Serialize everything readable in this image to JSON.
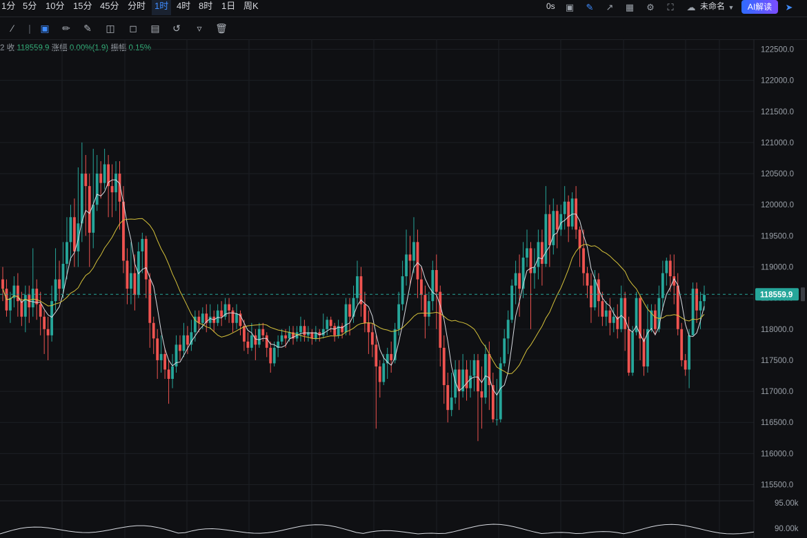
{
  "topbar": {
    "intervals": [
      "1分",
      "5分",
      "10分",
      "15分",
      "45分",
      "分时",
      "1时",
      "4时",
      "8时",
      "1日",
      "周K"
    ],
    "active_interval": "1时",
    "countdown": "0s",
    "layout_name": "未命名",
    "ai_button": "AI解读"
  },
  "toolbar": {
    "tools": [
      "line-tool-icon",
      "select-icon",
      "ruler-icon",
      "brush-icon",
      "candle-style-icon",
      "square-tool-icon",
      "note-icon",
      "magnet-icon",
      "filter-icon",
      "trash-icon"
    ]
  },
  "info": {
    "prefix": "2",
    "close_label": "收",
    "close_value": "118559.9",
    "change_label": "涨幅",
    "change_value": "0.00%(1.9)",
    "amp_label": "振幅",
    "amp_value": "0.15%"
  },
  "colors": {
    "up": "#26a69a",
    "down": "#ef5350",
    "ma_fast": "#d9dce2",
    "ma_slow": "#d6c23a",
    "price_tag": "#26a69a"
  },
  "chart_data": {
    "type": "candlestick",
    "y_ticks": [
      "122500.0",
      "122000.0",
      "121500.0",
      "121000.0",
      "120500.0",
      "120000.0",
      "119500.0",
      "119000.0",
      "118500.0",
      "118000.0",
      "117500.0",
      "117000.0",
      "116500.0",
      "116000.0",
      "115500.0"
    ],
    "ylim": [
      115500,
      122500
    ],
    "last_price": "118559.9",
    "last_price_value": 118559.9,
    "volume_ticks": [
      "95.00k",
      "90.00k"
    ],
    "candles": [
      [
        118800,
        118650,
        118450,
        119000
      ],
      [
        118650,
        118300,
        118200,
        118800
      ],
      [
        118300,
        118500,
        118100,
        118600
      ],
      [
        118500,
        118700,
        118350,
        118850
      ],
      [
        118700,
        118450,
        118200,
        118900
      ],
      [
        118450,
        118200,
        118050,
        118600
      ],
      [
        118200,
        118550,
        117950,
        118700
      ],
      [
        118550,
        118350,
        118100,
        118700
      ],
      [
        118350,
        118650,
        118200,
        119300
      ],
      [
        118650,
        118400,
        118150,
        118800
      ],
      [
        118400,
        118200,
        117900,
        118600
      ],
      [
        118200,
        118000,
        117600,
        118300
      ],
      [
        118000,
        117900,
        117500,
        118200
      ],
      [
        117900,
        118450,
        117800,
        118700
      ],
      [
        118450,
        118800,
        118300,
        119300
      ],
      [
        118800,
        118650,
        118450,
        119100
      ],
      [
        118650,
        119050,
        118500,
        119400
      ],
      [
        119050,
        119400,
        118800,
        119800
      ],
      [
        119400,
        119800,
        119100,
        120000
      ],
      [
        119800,
        119250,
        119000,
        120100
      ],
      [
        119250,
        119700,
        119000,
        120600
      ],
      [
        119700,
        120500,
        119400,
        121000
      ],
      [
        120500,
        120300,
        119500,
        120800
      ],
      [
        120300,
        119550,
        119000,
        120500
      ],
      [
        119550,
        120000,
        119300,
        120900
      ],
      [
        120000,
        120500,
        119900,
        120800
      ],
      [
        120500,
        120350,
        120100,
        120700
      ],
      [
        120350,
        120650,
        120250,
        120900
      ],
      [
        120650,
        120300,
        119800,
        120800
      ],
      [
        120300,
        120200,
        119800,
        120650
      ],
      [
        120200,
        120500,
        119900,
        120700
      ],
      [
        120500,
        120050,
        119600,
        120700
      ],
      [
        120050,
        119100,
        118900,
        120300
      ],
      [
        119100,
        118650,
        118400,
        119300
      ],
      [
        118650,
        118900,
        118400,
        119400
      ],
      [
        118900,
        118550,
        118300,
        119200
      ],
      [
        118550,
        119250,
        118500,
        119400
      ],
      [
        119250,
        119450,
        118900,
        119550
      ],
      [
        119450,
        118800,
        118500,
        119500
      ],
      [
        118800,
        118100,
        117700,
        118900
      ],
      [
        118100,
        117850,
        117600,
        118200
      ],
      [
        117850,
        117500,
        117200,
        118000
      ],
      [
        117500,
        117600,
        117300,
        117900
      ],
      [
        117600,
        117350,
        117200,
        117700
      ],
      [
        117350,
        117200,
        116800,
        117500
      ],
      [
        117200,
        117400,
        117050,
        117600
      ],
      [
        117400,
        117750,
        117300,
        117900
      ],
      [
        117750,
        117650,
        117500,
        117900
      ],
      [
        117650,
        117900,
        117550,
        118100
      ],
      [
        117900,
        117750,
        117600,
        118050
      ],
      [
        117750,
        117950,
        117650,
        118150
      ],
      [
        117950,
        118200,
        117800,
        118300
      ],
      [
        118200,
        118100,
        117950,
        118300
      ],
      [
        118100,
        118250,
        118000,
        118350
      ],
      [
        118250,
        118100,
        117950,
        118400
      ],
      [
        118100,
        118200,
        118000,
        118400
      ],
      [
        118200,
        118100,
        117950,
        118300
      ],
      [
        118100,
        118300,
        118050,
        118400
      ],
      [
        118300,
        118200,
        118050,
        118450
      ],
      [
        118200,
        118400,
        118150,
        118500
      ],
      [
        118400,
        118300,
        118100,
        118500
      ],
      [
        118300,
        118100,
        117950,
        118350
      ],
      [
        118100,
        118250,
        118000,
        118400
      ],
      [
        118250,
        118050,
        117900,
        118300
      ],
      [
        118050,
        117800,
        117650,
        118150
      ],
      [
        117800,
        117700,
        117600,
        117950
      ],
      [
        117700,
        117900,
        117650,
        118100
      ],
      [
        117900,
        117750,
        117500,
        118000
      ],
      [
        117750,
        118000,
        117700,
        118100
      ],
      [
        118000,
        117900,
        117800,
        118100
      ],
      [
        117900,
        117700,
        117550,
        117950
      ],
      [
        117700,
        117450,
        117300,
        117800
      ],
      [
        117450,
        117700,
        117400,
        117800
      ],
      [
        117700,
        117800,
        117550,
        117900
      ],
      [
        117800,
        117900,
        117750,
        118000
      ],
      [
        117900,
        117850,
        117700,
        118000
      ],
      [
        117850,
        117950,
        117800,
        118050
      ],
      [
        117950,
        117850,
        117750,
        118050
      ],
      [
        117850,
        117950,
        117800,
        118050
      ],
      [
        117950,
        118050,
        117800,
        118200
      ],
      [
        118050,
        117900,
        117800,
        118150
      ],
      [
        117900,
        117950,
        117800,
        118050
      ],
      [
        117950,
        117850,
        117750,
        118000
      ],
      [
        117850,
        117950,
        117800,
        118050
      ],
      [
        117950,
        117900,
        117800,
        118000
      ],
      [
        117900,
        118000,
        117850,
        118250
      ],
      [
        118000,
        118150,
        117900,
        118200
      ],
      [
        118150,
        118050,
        117950,
        118200
      ],
      [
        118050,
        117900,
        117800,
        118100
      ],
      [
        117900,
        118050,
        117850,
        118150
      ],
      [
        118050,
        117950,
        117850,
        118100
      ],
      [
        117950,
        118400,
        117900,
        118500
      ],
      [
        118400,
        118200,
        117900,
        118500
      ],
      [
        118200,
        118500,
        118100,
        118700
      ],
      [
        118500,
        118850,
        118400,
        119100
      ],
      [
        118850,
        118400,
        118200,
        119000
      ],
      [
        118400,
        118100,
        117950,
        118600
      ],
      [
        118100,
        117950,
        117600,
        118300
      ],
      [
        117950,
        117750,
        117550,
        118100
      ],
      [
        117750,
        117400,
        116400,
        117900
      ],
      [
        117400,
        117150,
        116900,
        117500
      ],
      [
        117150,
        117450,
        117100,
        117600
      ],
      [
        117450,
        117600,
        117200,
        117700
      ],
      [
        117600,
        117500,
        117300,
        117800
      ],
      [
        117500,
        118000,
        117450,
        118100
      ],
      [
        118000,
        118400,
        117900,
        118600
      ],
      [
        118400,
        118850,
        118300,
        119100
      ],
      [
        118850,
        119200,
        118700,
        119600
      ],
      [
        119200,
        119100,
        118700,
        119500
      ],
      [
        119100,
        119400,
        118900,
        119800
      ],
      [
        119400,
        118800,
        118500,
        119600
      ],
      [
        118800,
        118550,
        118300,
        119000
      ],
      [
        118550,
        118200,
        117850,
        118700
      ],
      [
        118200,
        118450,
        118050,
        118600
      ],
      [
        118450,
        118950,
        118300,
        119100
      ],
      [
        118950,
        118600,
        118000,
        119200
      ],
      [
        118600,
        117700,
        117400,
        118700
      ],
      [
        117700,
        117100,
        116800,
        117900
      ],
      [
        117100,
        116700,
        116500,
        117300
      ],
      [
        116700,
        116900,
        116600,
        117300
      ],
      [
        116900,
        117350,
        116800,
        117500
      ],
      [
        117350,
        117000,
        116700,
        117500
      ],
      [
        117000,
        117350,
        116900,
        117600
      ],
      [
        117350,
        117050,
        116850,
        117500
      ],
      [
        117050,
        117250,
        116900,
        117500
      ],
      [
        117250,
        117500,
        117000,
        117600
      ],
      [
        117500,
        117000,
        116200,
        117600
      ],
      [
        117000,
        116900,
        116400,
        117400
      ],
      [
        116900,
        117600,
        116800,
        117750
      ],
      [
        117600,
        117100,
        116700,
        117800
      ],
      [
        117100,
        116550,
        116500,
        117300
      ],
      [
        116550,
        116550,
        116450,
        117200
      ],
      [
        116550,
        117450,
        116500,
        117550
      ],
      [
        117450,
        117850,
        117400,
        118000
      ],
      [
        117850,
        118150,
        117600,
        118300
      ],
      [
        118150,
        118700,
        118100,
        118800
      ],
      [
        118700,
        118900,
        118400,
        119100
      ],
      [
        118900,
        118650,
        118200,
        119200
      ],
      [
        118650,
        119150,
        118500,
        119400
      ],
      [
        119150,
        119300,
        119000,
        119600
      ],
      [
        119300,
        118900,
        118000,
        119400
      ],
      [
        118900,
        119000,
        118650,
        119300
      ],
      [
        119000,
        119400,
        118800,
        119600
      ],
      [
        119400,
        119050,
        118700,
        119600
      ],
      [
        119050,
        119850,
        119000,
        120300
      ],
      [
        119850,
        119350,
        119000,
        120000
      ],
      [
        119350,
        119900,
        119200,
        120100
      ],
      [
        119900,
        119600,
        119300,
        120000
      ],
      [
        119600,
        119850,
        119500,
        120000
      ],
      [
        119850,
        120050,
        119600,
        120300
      ],
      [
        120050,
        119650,
        119400,
        120150
      ],
      [
        119650,
        120100,
        119600,
        120200
      ],
      [
        120100,
        119600,
        119450,
        120300
      ],
      [
        119600,
        119300,
        119000,
        119650
      ],
      [
        119300,
        118900,
        118700,
        119600
      ],
      [
        118900,
        118700,
        118500,
        119000
      ],
      [
        118700,
        118350,
        118100,
        118900
      ],
      [
        118350,
        118800,
        118300,
        118950
      ],
      [
        118800,
        118450,
        118200,
        118900
      ],
      [
        118450,
        118200,
        118050,
        118600
      ],
      [
        118200,
        118300,
        118050,
        118450
      ],
      [
        118300,
        118100,
        117900,
        118500
      ],
      [
        118100,
        118200,
        117950,
        118350
      ],
      [
        118200,
        118000,
        117850,
        118400
      ],
      [
        118000,
        118500,
        117950,
        118700
      ],
      [
        118500,
        118000,
        117650,
        118600
      ],
      [
        118000,
        117300,
        117250,
        118200
      ],
      [
        117300,
        117950,
        117250,
        118050
      ],
      [
        117950,
        118500,
        117900,
        118600
      ],
      [
        118500,
        117850,
        117500,
        118550
      ],
      [
        117850,
        117400,
        117250,
        118000
      ],
      [
        117400,
        118000,
        117300,
        118400
      ],
      [
        118000,
        118300,
        117950,
        118400
      ],
      [
        118300,
        118000,
        117900,
        118400
      ],
      [
        118000,
        118500,
        117950,
        118700
      ],
      [
        118500,
        118900,
        118300,
        119100
      ],
      [
        118900,
        119100,
        118700,
        119150
      ],
      [
        119100,
        118850,
        118600,
        119200
      ],
      [
        118850,
        118700,
        118400,
        119200
      ],
      [
        118700,
        118000,
        117900,
        118900
      ],
      [
        118000,
        117500,
        117400,
        118100
      ],
      [
        117500,
        117350,
        117250,
        117600
      ],
      [
        117350,
        117900,
        117050,
        118000
      ],
      [
        117900,
        118650,
        117900,
        118750
      ],
      [
        118650,
        118300,
        118100,
        118750
      ],
      [
        118300,
        118450,
        118000,
        118600
      ],
      [
        118450,
        118550,
        118300,
        118700
      ]
    ]
  }
}
